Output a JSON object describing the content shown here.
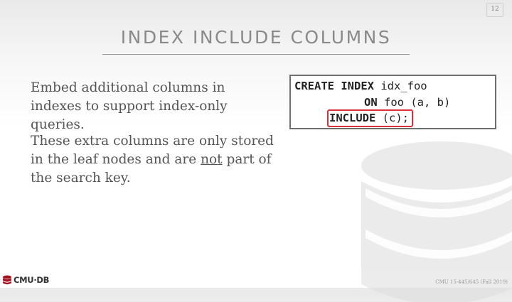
{
  "slide": {
    "number": "12",
    "title": "INDEX INCLUDE COLUMNS",
    "body": {
      "p1": "Embed additional columns in indexes to support index-only queries.",
      "p2_part1": "These extra columns are only stored in the leaf nodes and are ",
      "p2_underlined": "not",
      "p2_part2": " part of the search key."
    },
    "code": {
      "line1_keyword": "CREATE INDEX",
      "line1_rest": " idx_foo",
      "line2_keyword": "ON",
      "line2_rest": " foo (a, b)",
      "line3_keyword": "INCLUDE",
      "line3_rest": " (c)",
      "line3_end": ";"
    },
    "highlight_color": "#d9303a",
    "logo_text": "CMU·DB",
    "footer": "CMU 15-445/645 (Fall 2019)"
  }
}
